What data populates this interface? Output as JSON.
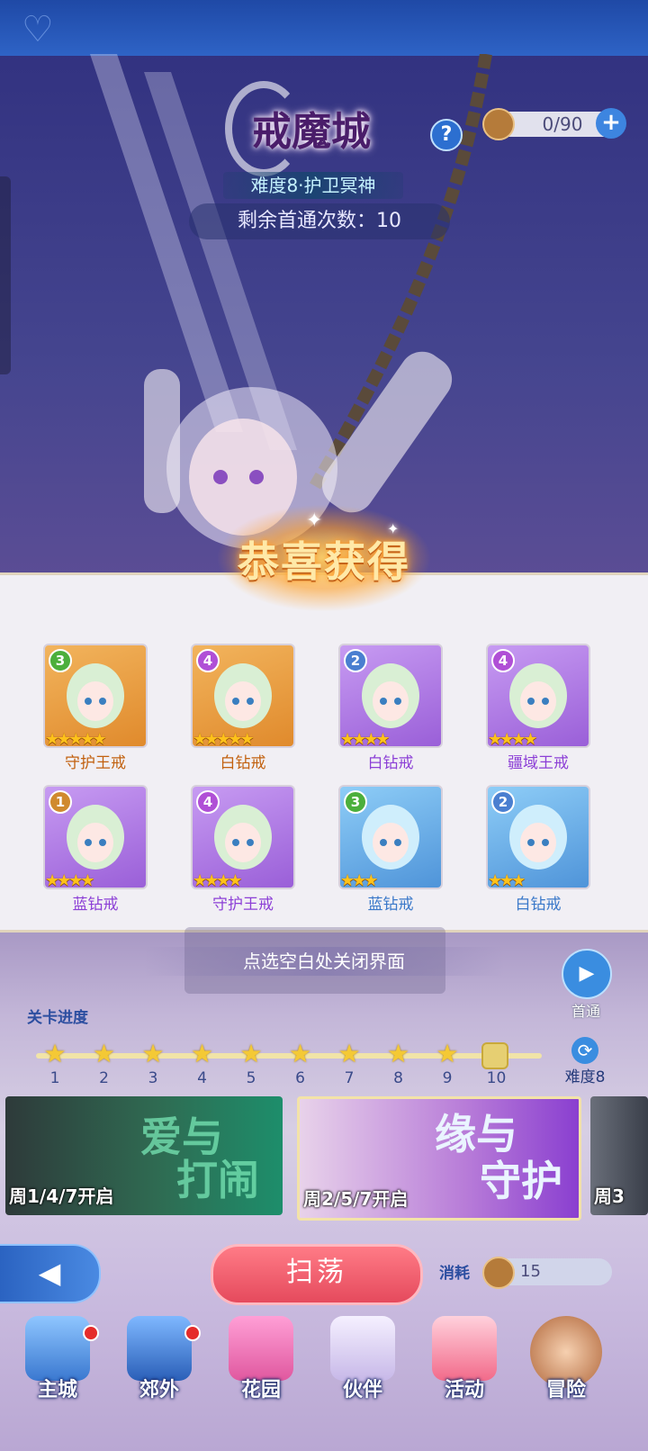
{
  "header": {
    "title": "戒魔城",
    "difficulty": "难度8·护卫冥神",
    "remaining_label": "剩余首通次数：10"
  },
  "resource": {
    "value": "0/90"
  },
  "reward_popup": {
    "title": "恭喜获得",
    "close_hint": "点选空白处关闭界面",
    "items": [
      {
        "level": "3",
        "name": "守护王戒",
        "stars": 5,
        "frame": "orange"
      },
      {
        "level": "4",
        "name": "白钻戒",
        "stars": 5,
        "frame": "orange"
      },
      {
        "level": "2",
        "name": "白钻戒",
        "stars": 4,
        "frame": "purple"
      },
      {
        "level": "4",
        "name": "疆域王戒",
        "stars": 4,
        "frame": "purple"
      },
      {
        "level": "1",
        "name": "蓝钻戒",
        "stars": 4,
        "frame": "purple"
      },
      {
        "level": "4",
        "name": "守护王戒",
        "stars": 4,
        "frame": "purple"
      },
      {
        "level": "3",
        "name": "蓝钻戒",
        "stars": 3,
        "frame": "blue"
      },
      {
        "level": "2",
        "name": "白钻戒",
        "stars": 3,
        "frame": "blue"
      }
    ]
  },
  "first_clear": {
    "label": "首通"
  },
  "progress": {
    "title": "关卡进度",
    "stages": [
      "1",
      "2",
      "3",
      "4",
      "5",
      "6",
      "7",
      "8",
      "9",
      "10"
    ],
    "difficulty_button": "难度8"
  },
  "banners": [
    {
      "title_line1": "爱与",
      "title_line2": "打闹",
      "schedule": "周1/4/7开启"
    },
    {
      "title_line1": "缘与",
      "title_line2": "守护",
      "schedule": "周2/5/7开启"
    },
    {
      "schedule": "周3"
    }
  ],
  "actions": {
    "sweep": "扫荡",
    "cost_label": "消耗",
    "cost_value": "15"
  },
  "nav": [
    "主城",
    "郊外",
    "花园",
    "伙伴",
    "活动",
    "冒险"
  ],
  "colors": {
    "accent_blue": "#2e63c6",
    "sweep_red": "#e54a5d",
    "star_gold": "#ffc21a"
  }
}
